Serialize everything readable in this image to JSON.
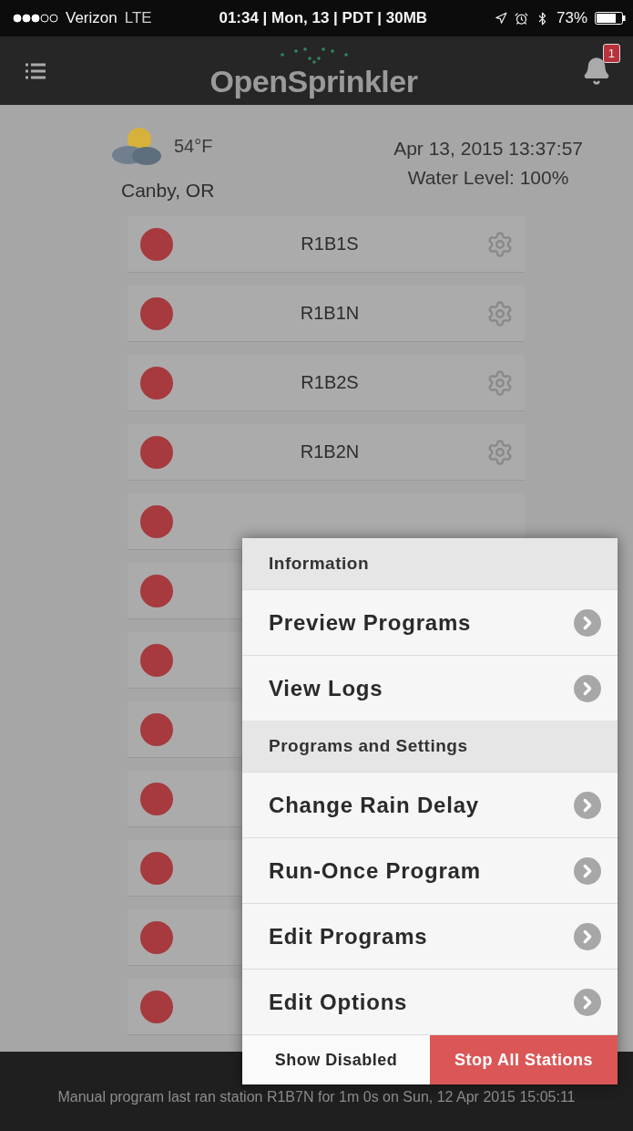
{
  "status_bar": {
    "carrier": "Verizon",
    "network": "LTE",
    "center": "01:34 | Mon, 13 | PDT | 30MB",
    "battery": "73%"
  },
  "header": {
    "title": "OpenSprinkler",
    "notification_count": "1"
  },
  "weather": {
    "temperature": "54°F",
    "location": "Canby, OR"
  },
  "controller": {
    "datetime": "Apr 13, 2015 13:37:57",
    "water_level": "Water Level: 100%"
  },
  "stations": [
    {
      "kind": "station",
      "name": "R1B1S"
    },
    {
      "kind": "station",
      "name": "R1B1N"
    },
    {
      "kind": "station",
      "name": "R1B2S"
    },
    {
      "kind": "station",
      "name": "R1B2N"
    },
    {
      "kind": "covered"
    },
    {
      "kind": "covered"
    },
    {
      "kind": "covered"
    },
    {
      "kind": "covered"
    },
    {
      "kind": "covered"
    },
    {
      "kind": "covered"
    },
    {
      "kind": "covered"
    },
    {
      "kind": "covered"
    }
  ],
  "menu": {
    "sections": [
      {
        "title": "Information",
        "items": [
          "Preview Programs",
          "View Logs"
        ]
      },
      {
        "title": "Programs and Settings",
        "items": [
          "Change Rain Delay",
          "Run-Once Program",
          "Edit Programs",
          "Edit Options"
        ]
      }
    ],
    "buttons": [
      {
        "label": "Show Disabled",
        "kind": "plain"
      },
      {
        "label": "Stop All Stations",
        "kind": "danger"
      }
    ]
  },
  "footer": {
    "text": "Manual program last ran station R1B7N for 1m 0s on Sun, 12 Apr 2015 15:05:11"
  }
}
